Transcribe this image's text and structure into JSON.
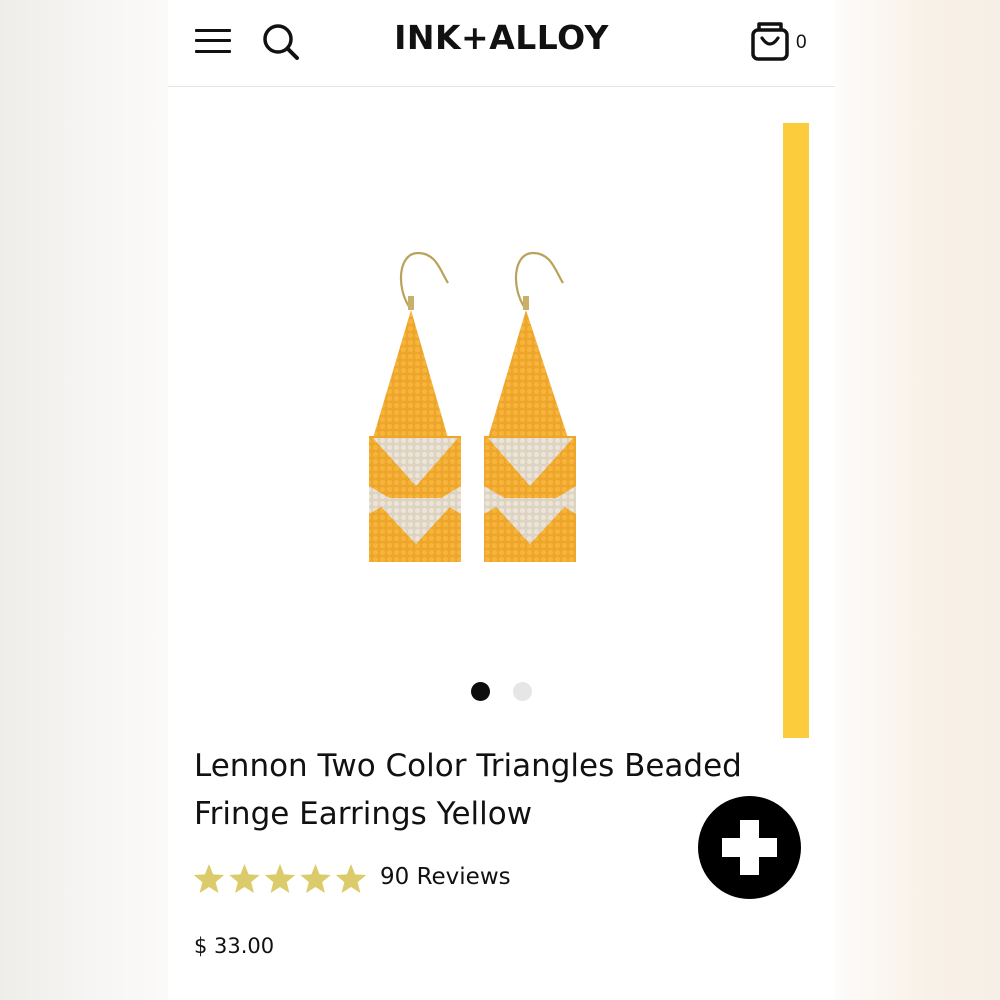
{
  "header": {
    "logo": "INK+ALLOY",
    "cart_count": "0"
  },
  "gallery": {
    "pager_count": 2,
    "active_index": 0
  },
  "product": {
    "title_line1": "Lennon Two Color Triangles Beaded",
    "title_line2": "Fringe Earrings Yellow",
    "rating": 5,
    "reviews": "90 Reviews",
    "price": "$ 33.00"
  },
  "icons": {
    "menu": "hamburger-icon",
    "search": "search-icon",
    "cart": "shopping-bag-icon",
    "add": "plus-icon",
    "star": "star-icon"
  },
  "colors": {
    "accent_yellow": "#fdcc3c",
    "bead_yellow": "#f0aa2d",
    "bead_cream": "#e6ddcd",
    "star_gold": "#dccb6a",
    "dark": "#0d0d0d"
  }
}
